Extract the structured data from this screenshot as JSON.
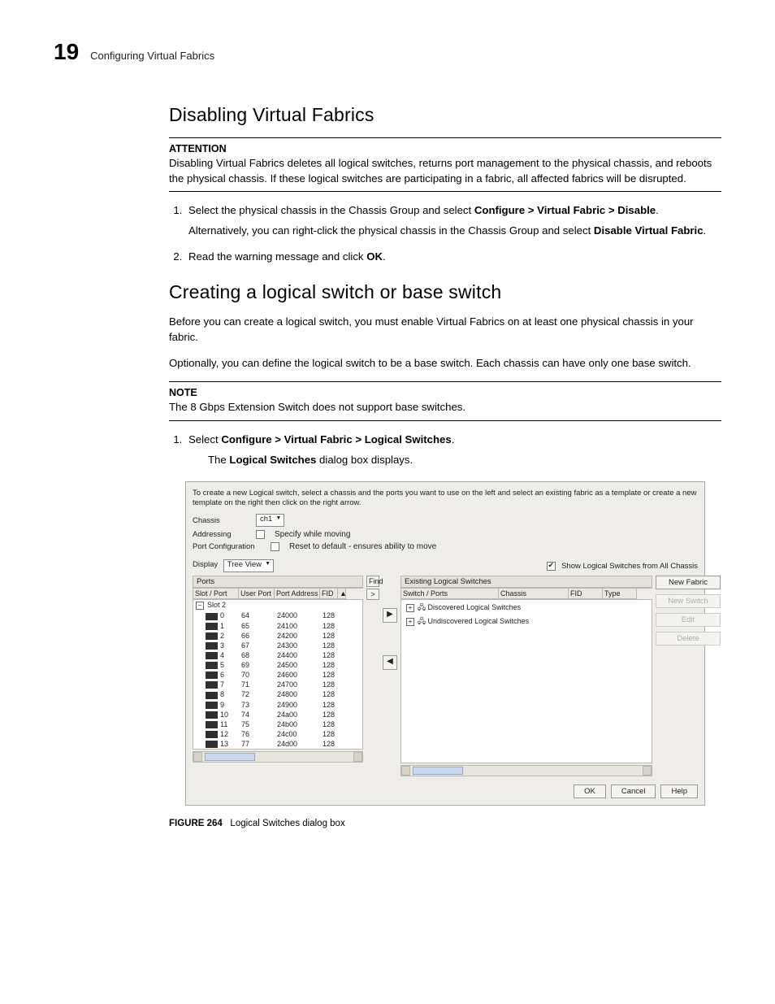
{
  "header": {
    "page_number": "19",
    "section_title": "Configuring Virtual Fabrics"
  },
  "s1": {
    "heading": "Disabling Virtual Fabrics",
    "attention_label": "ATTENTION",
    "attention_body": "Disabling Virtual Fabrics deletes all logical switches, returns port management to the physical chassis, and reboots the physical chassis. If these logical switches are participating in a fabric, all affected fabrics will be disrupted.",
    "step1_pre": "Select the physical chassis in the Chassis Group and select ",
    "step1_bold": "Configure > Virtual Fabric > Disable",
    "step1_post": ".",
    "step1_alt_pre": "Alternatively, you can right-click the physical chassis in the Chassis Group and select ",
    "step1_alt_bold": "Disable Virtual Fabric",
    "step1_alt_post": ".",
    "step2_pre": "Read the warning message and click ",
    "step2_bold": "OK",
    "step2_post": "."
  },
  "s2": {
    "heading": "Creating a logical switch or base switch",
    "intro1": "Before you can create a logical switch, you must enable Virtual Fabrics on at least one physical chassis in your fabric.",
    "intro2": "Optionally, you can define the logical switch to be a base switch. Each chassis can have only one base switch.",
    "note_label": "NOTE",
    "note_body": "The 8 Gbps Extension Switch does not support base switches.",
    "step1_pre": "Select ",
    "step1_bold": "Configure > Virtual Fabric > Logical Switches",
    "step1_post": ".",
    "step1_result_pre": "The ",
    "step1_result_bold": "Logical Switches",
    "step1_result_post": " dialog box displays."
  },
  "dlg": {
    "tip": "To create a new Logical switch, select a chassis and the ports you want to use on the left and select an existing fabric as a template or create a new template on the right then click on the right arrow.",
    "fields": {
      "chassis_label": "Chassis",
      "chassis_value": "ch1",
      "addressing_label": "Addressing",
      "addressing_chk": "Specify while moving",
      "portcfg_label": "Port Configuration",
      "portcfg_chk": "Reset to default - ensures ability to move",
      "display_label": "Display",
      "display_value": "Tree View",
      "show_all": "Show Logical Switches from All Chassis"
    },
    "left": {
      "title": "Ports",
      "cols": [
        "Slot / Port",
        "User Port #",
        "Port Address",
        "FID",
        ""
      ],
      "slot": "Slot 2",
      "rows": [
        {
          "p": "0",
          "u": "64",
          "a": "24000",
          "f": "128"
        },
        {
          "p": "1",
          "u": "65",
          "a": "24100",
          "f": "128"
        },
        {
          "p": "2",
          "u": "66",
          "a": "24200",
          "f": "128"
        },
        {
          "p": "3",
          "u": "67",
          "a": "24300",
          "f": "128"
        },
        {
          "p": "4",
          "u": "68",
          "a": "24400",
          "f": "128"
        },
        {
          "p": "5",
          "u": "69",
          "a": "24500",
          "f": "128"
        },
        {
          "p": "6",
          "u": "70",
          "a": "24600",
          "f": "128"
        },
        {
          "p": "7",
          "u": "71",
          "a": "24700",
          "f": "128"
        },
        {
          "p": "8",
          "u": "72",
          "a": "24800",
          "f": "128"
        },
        {
          "p": "9",
          "u": "73",
          "a": "24900",
          "f": "128"
        },
        {
          "p": "10",
          "u": "74",
          "a": "24a00",
          "f": "128"
        },
        {
          "p": "11",
          "u": "75",
          "a": "24b00",
          "f": "128"
        },
        {
          "p": "12",
          "u": "76",
          "a": "24c00",
          "f": "128"
        },
        {
          "p": "13",
          "u": "77",
          "a": "24d00",
          "f": "128"
        }
      ],
      "find": "Find"
    },
    "right": {
      "title": "Existing Logical Switches",
      "cols": [
        "Switch / Ports",
        "Chassis",
        "FID",
        "Type"
      ],
      "line1": "Discovered Logical Switches",
      "line2": "Undiscovered Logical Switches"
    },
    "buttons": {
      "new_fabric": "New Fabric",
      "new_switch": "New Switch",
      "edit": "Edit",
      "delete": "Delete",
      "ok": "OK",
      "cancel": "Cancel",
      "help": "Help"
    }
  },
  "figure": {
    "label": "FIGURE 264",
    "caption": "Logical Switches dialog box"
  }
}
